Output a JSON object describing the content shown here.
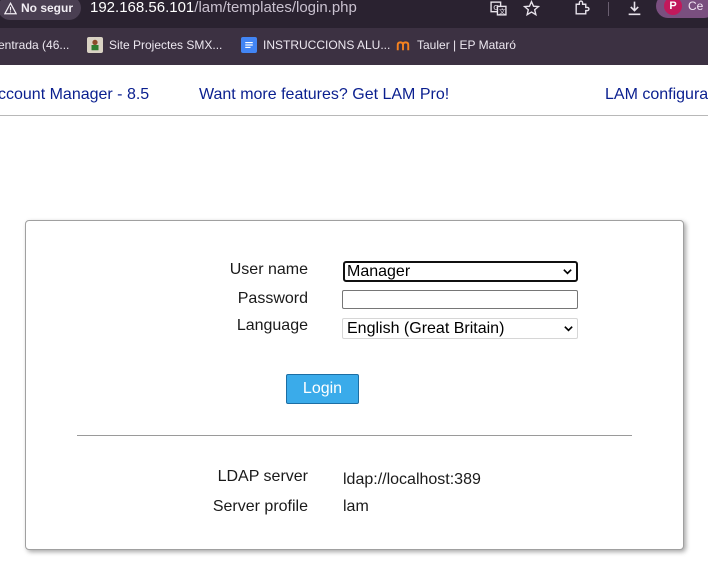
{
  "browser": {
    "security_label": "No segur",
    "url_host": "192.168.56.101",
    "url_path": "/lam/templates/login.php",
    "profile_initial": "P",
    "profile_label": "Ce",
    "bookmarks": [
      {
        "label": "entrada (46..."
      },
      {
        "label": "Site Projectes SMX..."
      },
      {
        "label": "INSTRUCCIONS ALU..."
      },
      {
        "label": "Tauler | EP Mataró"
      }
    ]
  },
  "header": {
    "title": "ccount Manager - 8.5",
    "pro_link": "Want more features? Get LAM Pro!",
    "config_link": "LAM configura"
  },
  "login": {
    "username_label": "User name",
    "username_value": "Manager",
    "password_label": "Password",
    "language_label": "Language",
    "language_value": "English (Great Britain)",
    "login_button": "Login",
    "ldap_server_label": "LDAP server",
    "ldap_server_value": "ldap://localhost:389",
    "server_profile_label": "Server profile",
    "server_profile_value": "lam"
  },
  "colors": {
    "link": "#0a1f8f",
    "button": "#3aabea",
    "chrome_bg": "#3c3142"
  }
}
